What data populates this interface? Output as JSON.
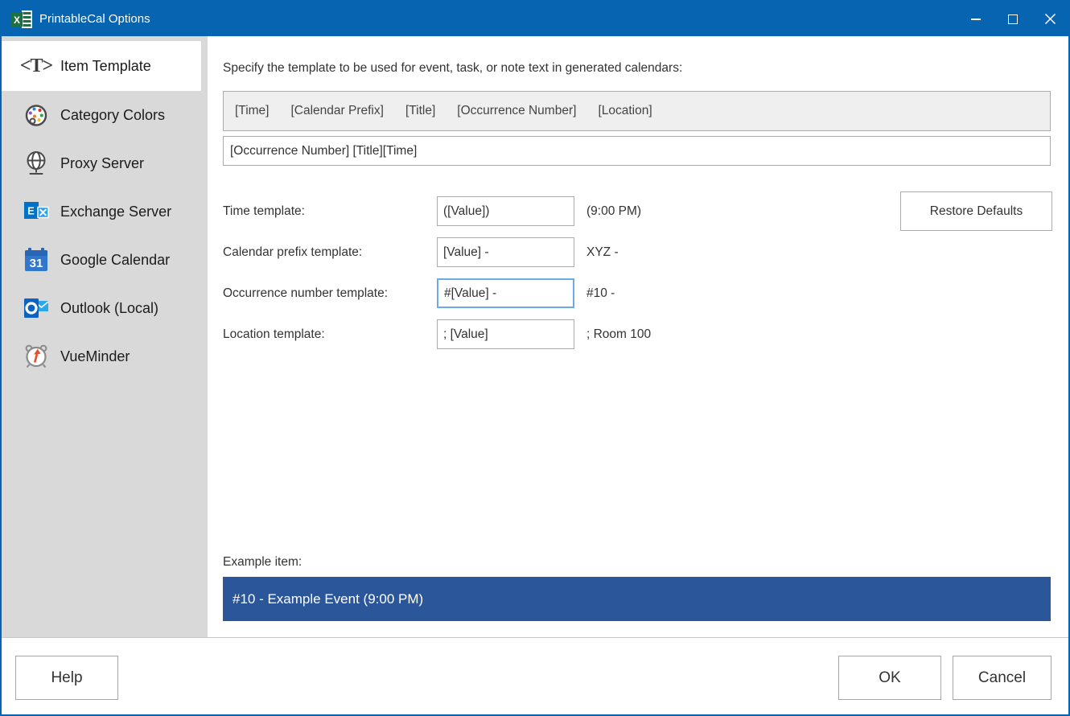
{
  "window": {
    "title": "PrintableCal Options"
  },
  "sidebar": {
    "items": [
      {
        "label": "Item Template",
        "icon": "item-template-icon",
        "selected": true
      },
      {
        "label": "Category Colors",
        "icon": "palette-icon",
        "selected": false
      },
      {
        "label": "Proxy Server",
        "icon": "globe-icon",
        "selected": false
      },
      {
        "label": "Exchange Server",
        "icon": "exchange-icon",
        "selected": false
      },
      {
        "label": "Google Calendar",
        "icon": "google-calendar-icon",
        "selected": false
      },
      {
        "label": "Outlook (Local)",
        "icon": "outlook-icon",
        "selected": false
      },
      {
        "label": "VueMinder",
        "icon": "alarm-clock-icon",
        "selected": false
      }
    ]
  },
  "main": {
    "instruction": "Specify the template to be used for event, task, or note text in generated calendars:",
    "tokens": [
      "[Time]",
      "[Calendar Prefix]",
      "[Title]",
      "[Occurrence Number]",
      "[Location]"
    ],
    "template_value": "[Occurrence Number] [Title][Time]",
    "fields": [
      {
        "label": "Time template:",
        "value": "([Value])",
        "example": "(9:00 PM)",
        "focused": false
      },
      {
        "label": "Calendar prefix template:",
        "value": "[Value] -",
        "example": "XYZ -",
        "focused": false
      },
      {
        "label": "Occurrence number template:",
        "value": "#[Value] -",
        "example": "#10 -",
        "focused": true
      },
      {
        "label": "Location template:",
        "value": "; [Value]",
        "example": "; Room 100",
        "focused": false
      }
    ],
    "restore_defaults_label": "Restore Defaults",
    "example_label": "Example item:",
    "example_item": "#10 - Example Event (9:00 PM)"
  },
  "footer": {
    "help_label": "Help",
    "ok_label": "OK",
    "cancel_label": "Cancel"
  },
  "icons": {
    "item_template_glyph": "<T>",
    "exchange_letter": "E",
    "google_day": "31"
  },
  "colors": {
    "titlebar_blue": "#0664B1",
    "sidebar_gray": "#D9D9D9",
    "token_bar_bg": "#EFEFEF",
    "border_gray": "#ABABAB",
    "focused_input_border": "#6CACE4",
    "example_bar_blue": "#2B5699"
  }
}
